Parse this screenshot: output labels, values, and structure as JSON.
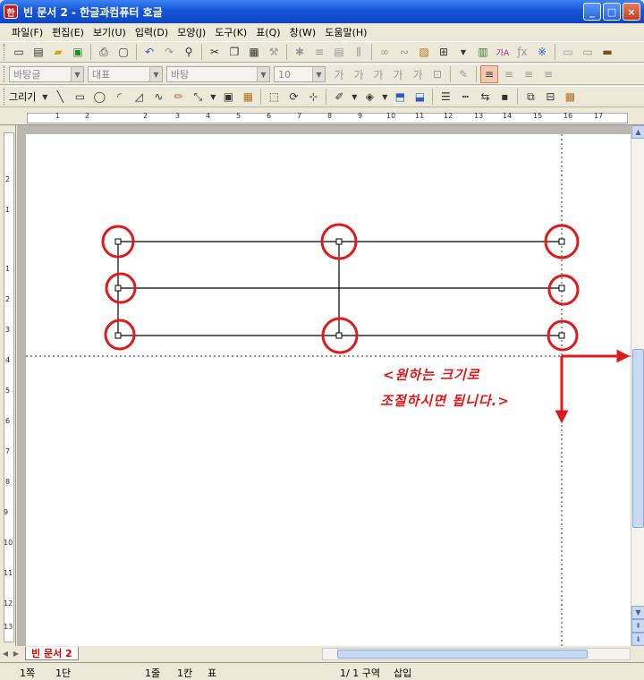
{
  "window": {
    "title": "빈 문서 2 - 한글과컴퓨터 호글",
    "app_icon": "hwp-app-icon",
    "min_label": "_",
    "max_label": "□",
    "close_label": "×"
  },
  "menu": [
    "파일(F)",
    "편집(E)",
    "보기(U)",
    "입력(D)",
    "모양(J)",
    "도구(K)",
    "표(Q)",
    "창(W)",
    "도움말(H)"
  ],
  "format_toolbar": {
    "style": "바탕글",
    "font_lang": "대표",
    "font": "바탕",
    "size": "10"
  },
  "draw_toolbar": {
    "label": "그리기"
  },
  "ruler_h_numbers": [
    "1",
    "2",
    "1",
    "2",
    "3",
    "4",
    "5",
    "6",
    "7",
    "8",
    "9",
    "10",
    "11",
    "12",
    "13",
    "14",
    "15",
    "16",
    "17"
  ],
  "ruler_v_numbers": [
    "2",
    "1",
    "1",
    "2",
    "3",
    "4",
    "5",
    "6",
    "7",
    "8",
    "9",
    "10",
    "11",
    "12",
    "13"
  ],
  "annotation": {
    "line1": "<원하는  크기로",
    "line2": "조절하시면 됩니다.>"
  },
  "tab": {
    "label": "빈 문서 2"
  },
  "status": {
    "page": "1쪽",
    "col": "1단",
    "row": "1줄",
    "cell": "1칸",
    "mode": "표",
    "section_of": "1/ 1 구역",
    "insert": "삽입"
  },
  "colors": {
    "annotation": "#e01a1a",
    "titlebar": "#0d47c4"
  }
}
